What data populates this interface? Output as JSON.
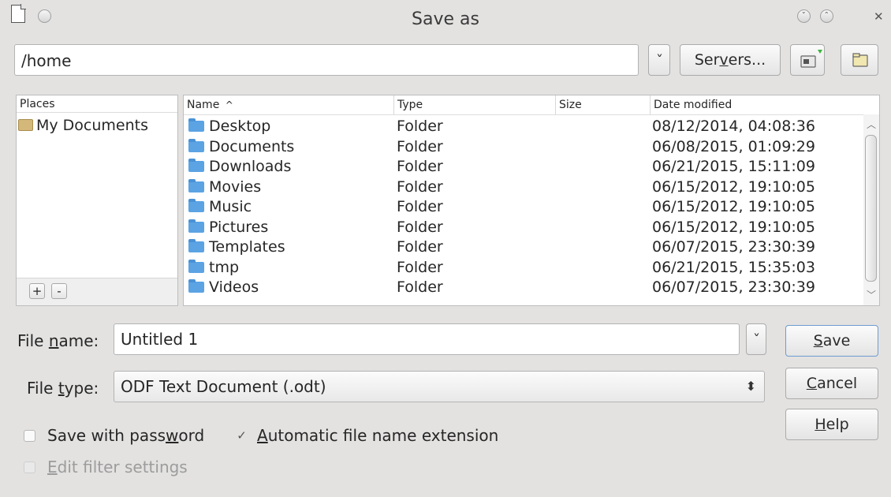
{
  "window": {
    "title": "Save as"
  },
  "location": {
    "path": "/home",
    "servers_label": "Servers...",
    "servers_mnemonic": "v"
  },
  "places": {
    "header": "Places",
    "items": [
      {
        "label": "My Documents"
      }
    ],
    "add_label": "+",
    "remove_label": "-"
  },
  "file_list": {
    "columns": {
      "name": "Name",
      "type": "Type",
      "size": "Size",
      "date": "Date modified"
    },
    "rows": [
      {
        "name": "Desktop",
        "type": "Folder",
        "size": "",
        "date": "08/12/2014, 04:08:36"
      },
      {
        "name": "Documents",
        "type": "Folder",
        "size": "",
        "date": "06/08/2015, 01:09:29"
      },
      {
        "name": "Downloads",
        "type": "Folder",
        "size": "",
        "date": "06/21/2015, 15:11:09"
      },
      {
        "name": "Movies",
        "type": "Folder",
        "size": "",
        "date": "06/15/2012, 19:10:05"
      },
      {
        "name": "Music",
        "type": "Folder",
        "size": "",
        "date": "06/15/2012, 19:10:05"
      },
      {
        "name": "Pictures",
        "type": "Folder",
        "size": "",
        "date": "06/15/2012, 19:10:05"
      },
      {
        "name": "Templates",
        "type": "Folder",
        "size": "",
        "date": "06/07/2015, 23:30:39"
      },
      {
        "name": "tmp",
        "type": "Folder",
        "size": "",
        "date": "06/21/2015, 15:35:03"
      },
      {
        "name": "Videos",
        "type": "Folder",
        "size": "",
        "date": "06/07/2015, 23:30:39"
      }
    ]
  },
  "form": {
    "file_name_label": {
      "pre": "File ",
      "mnemonic": "n",
      "post": "ame:"
    },
    "file_name_value": "Untitled 1",
    "file_type_label": {
      "pre": "File ",
      "mnemonic": "t",
      "post": "ype:"
    },
    "file_type_value": "ODF Text Document (.odt)",
    "save_with_password": {
      "pre": "Save with pass",
      "mnemonic": "w",
      "post": "ord",
      "checked": false
    },
    "auto_extension": {
      "pre": "",
      "mnemonic": "A",
      "post": "utomatic file name extension",
      "checked": true
    },
    "edit_filter": {
      "pre": "",
      "mnemonic": "E",
      "post": "dit filter settings",
      "checked": false,
      "enabled": false
    }
  },
  "buttons": {
    "save": {
      "mnemonic": "S",
      "rest": "ave"
    },
    "cancel": {
      "mnemonic": "C",
      "rest": "ancel"
    },
    "help": {
      "mnemonic": "H",
      "rest": "elp"
    }
  },
  "colors": {
    "window_bg": "#e3e2e1",
    "folder_icon": "#5ba3e3",
    "field_bg": "#ffffff"
  },
  "icons": {
    "title_doc": "document-icon",
    "folder": "folder-icon",
    "my_documents": "home-folder-icon",
    "new_folder": "new-folder-icon",
    "folder_view": "folder-icon",
    "sort": "sort-ascending-icon"
  }
}
